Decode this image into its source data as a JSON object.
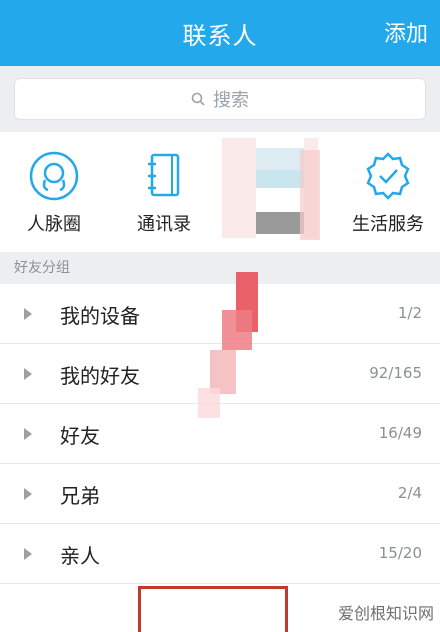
{
  "header": {
    "title": "联系人",
    "add_label": "添加"
  },
  "search": {
    "placeholder": "搜索"
  },
  "quick_actions": [
    {
      "label": "人脉圈",
      "icon": "contacts-circle-icon"
    },
    {
      "label": "通讯录",
      "icon": "address-book-icon"
    },
    {
      "label": "",
      "icon": "pixelated-icon"
    },
    {
      "label": "生活服务",
      "icon": "shield-check-icon"
    }
  ],
  "section_title": "好友分组",
  "groups": [
    {
      "name": "我的设备",
      "count": "1/2"
    },
    {
      "name": "我的好友",
      "count": "92/165"
    },
    {
      "name": "好友",
      "count": "16/49"
    },
    {
      "name": "兄弟",
      "count": "2/4"
    },
    {
      "name": "亲人",
      "count": "15/20"
    }
  ],
  "watermark": "爱创根知识网",
  "colors": {
    "header": "#23a8ec",
    "icon": "#23a8ec",
    "highlight": "#c0392b"
  }
}
